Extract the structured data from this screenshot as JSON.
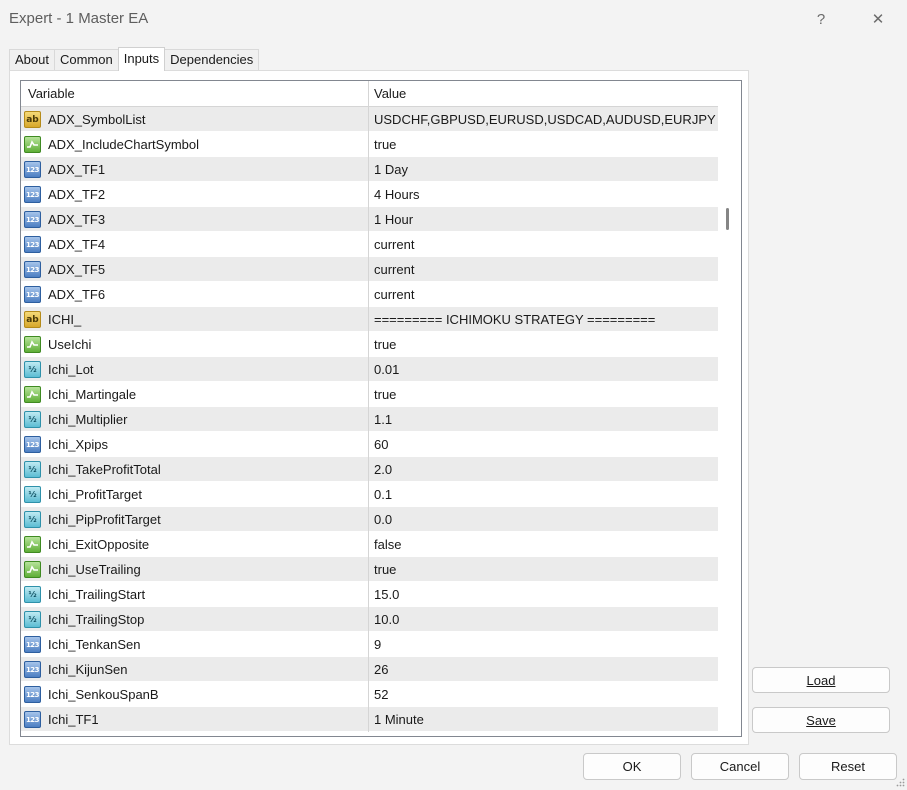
{
  "window": {
    "title": "Expert - 1 Master EA",
    "help_glyph": "?",
    "close_glyph": "✕"
  },
  "tabs": [
    {
      "label": "About",
      "active": false
    },
    {
      "label": "Common",
      "active": false
    },
    {
      "label": "Inputs",
      "active": true
    },
    {
      "label": "Dependencies",
      "active": false
    }
  ],
  "table": {
    "headers": {
      "variable": "Variable",
      "value": "Value"
    },
    "rows": [
      {
        "type": "string",
        "icon": "string-icon",
        "variable": "ADX_SymbolList",
        "value": "USDCHF,GBPUSD,EURUSD,USDCAD,AUDUSD,EURJPY"
      },
      {
        "type": "bool",
        "icon": "bool-icon",
        "variable": "ADX_IncludeChartSymbol",
        "value": "true"
      },
      {
        "type": "int",
        "icon": "integer-icon",
        "variable": "ADX_TF1",
        "value": "1 Day"
      },
      {
        "type": "int",
        "icon": "integer-icon",
        "variable": "ADX_TF2",
        "value": "4 Hours"
      },
      {
        "type": "int",
        "icon": "integer-icon",
        "variable": "ADX_TF3",
        "value": "1 Hour"
      },
      {
        "type": "int",
        "icon": "integer-icon",
        "variable": "ADX_TF4",
        "value": "current"
      },
      {
        "type": "int",
        "icon": "integer-icon",
        "variable": "ADX_TF5",
        "value": "current"
      },
      {
        "type": "int",
        "icon": "integer-icon",
        "variable": "ADX_TF6",
        "value": "current"
      },
      {
        "type": "string",
        "icon": "string-icon",
        "variable": "ICHI_",
        "value": "========= ICHIMOKU STRATEGY ========="
      },
      {
        "type": "bool",
        "icon": "bool-icon",
        "variable": "UseIchi",
        "value": "true"
      },
      {
        "type": "double",
        "icon": "double-icon",
        "variable": "Ichi_Lot",
        "value": "0.01"
      },
      {
        "type": "bool",
        "icon": "bool-icon",
        "variable": "Ichi_Martingale",
        "value": "true"
      },
      {
        "type": "double",
        "icon": "double-icon",
        "variable": "Ichi_Multiplier",
        "value": "1.1"
      },
      {
        "type": "int",
        "icon": "integer-icon",
        "variable": "Ichi_Xpips",
        "value": "60"
      },
      {
        "type": "double",
        "icon": "double-icon",
        "variable": "Ichi_TakeProfitTotal",
        "value": "2.0"
      },
      {
        "type": "double",
        "icon": "double-icon",
        "variable": "Ichi_ProfitTarget",
        "value": "0.1"
      },
      {
        "type": "double",
        "icon": "double-icon",
        "variable": "Ichi_PipProfitTarget",
        "value": "0.0"
      },
      {
        "type": "bool",
        "icon": "bool-icon",
        "variable": "Ichi_ExitOpposite",
        "value": "false"
      },
      {
        "type": "bool",
        "icon": "bool-icon",
        "variable": "Ichi_UseTrailing",
        "value": "true"
      },
      {
        "type": "double",
        "icon": "double-icon",
        "variable": "Ichi_TrailingStart",
        "value": "15.0"
      },
      {
        "type": "double",
        "icon": "double-icon",
        "variable": "Ichi_TrailingStop",
        "value": "10.0"
      },
      {
        "type": "int",
        "icon": "integer-icon",
        "variable": "Ichi_TenkanSen",
        "value": "9"
      },
      {
        "type": "int",
        "icon": "integer-icon",
        "variable": "Ichi_KijunSen",
        "value": "26"
      },
      {
        "type": "int",
        "icon": "integer-icon",
        "variable": "Ichi_SenkouSpanB",
        "value": "52"
      },
      {
        "type": "int",
        "icon": "integer-icon",
        "variable": "Ichi_TF1",
        "value": "1 Minute"
      }
    ]
  },
  "icon_glyphs": {
    "string": "ab",
    "int": "123",
    "double": "½"
  },
  "side_buttons": {
    "load": "Load",
    "save": "Save"
  },
  "buttons": {
    "ok": "OK",
    "cancel": "Cancel",
    "reset": "Reset"
  }
}
